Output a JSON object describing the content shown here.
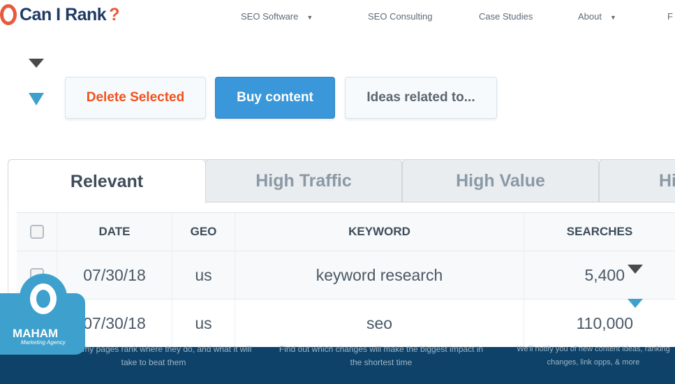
{
  "brand": {
    "name": "Can I Rank",
    "mark": "?"
  },
  "nav": [
    {
      "label": "SEO Software",
      "caret": "▼"
    },
    {
      "label": "SEO Consulting"
    },
    {
      "label": "Case Studies"
    },
    {
      "label": "About",
      "caret": "▼"
    },
    {
      "label": "F"
    }
  ],
  "toolbar": {
    "delete": "Delete Selected",
    "buy": "Buy content",
    "ideas": "Ideas related to...",
    "colors": {
      "delete": "#f2511b",
      "buy": "#3a97d9"
    }
  },
  "tabs": [
    {
      "label": "Relevant",
      "active": true
    },
    {
      "label": "High Traffic"
    },
    {
      "label": "High Value"
    },
    {
      "label": "Hi"
    }
  ],
  "table": {
    "headers": [
      "DATE",
      "GEO",
      "KEYWORD",
      "SEARCHES"
    ],
    "rows": [
      {
        "date": "07/30/18",
        "geo": "us",
        "keyword": "keyword research",
        "searches": "5,400"
      },
      {
        "date": "07/30/18",
        "geo": "us",
        "keyword": "seo",
        "searches": "110,000"
      }
    ]
  },
  "footer": [
    "Know why pages rank where they do, and what it will take to beat them",
    "Find out which changes will make the biggest impact in the shortest time",
    "We'll notify you of new content ideas, ranking changes, link opps, & more"
  ],
  "watermark": {
    "title": "MAHAM",
    "subtitle": "Marketing Agency"
  }
}
